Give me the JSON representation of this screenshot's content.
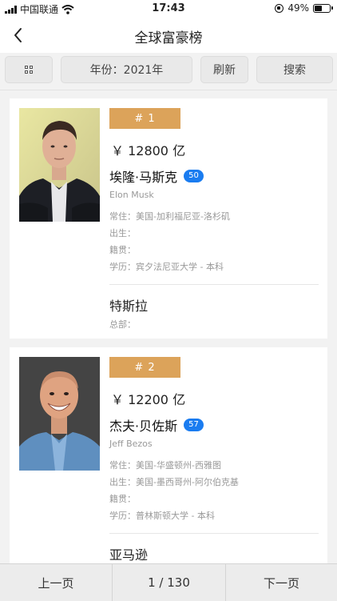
{
  "status_bar": {
    "carrier": "中国联通",
    "time": "17:43",
    "battery": "49%",
    "battery_level": 0.49
  },
  "nav": {
    "title": "全球富豪榜"
  },
  "toolbar": {
    "year_label": "年份：2021年",
    "refresh_label": "刷新",
    "search_label": "搜索"
  },
  "people": [
    {
      "rank": "# 1",
      "wealth": "￥ 12800 亿",
      "name": "埃隆·马斯克",
      "age": "50",
      "english_name": "Elon Musk",
      "residence": "常住：美国-加利福尼亚-洛杉矶",
      "birth": "出生：",
      "native": "籍贯：",
      "education": "学历：宾夕法尼亚大学 - 本科",
      "company": "特斯拉",
      "hq": "总部："
    },
    {
      "rank": "# 2",
      "wealth": "￥ 12200 亿",
      "name": "杰夫·贝佐斯",
      "age": "57",
      "english_name": "Jeff Bezos",
      "residence": "常住：美国-华盛顿州-西雅图",
      "birth": "出生：美国-墨西哥州-阿尔伯克基",
      "native": "籍贯：",
      "education": "学历：普林斯顿大学 - 本科",
      "company": "亚马逊",
      "hq": ""
    }
  ],
  "pager": {
    "prev_label": "上一页",
    "page_indicator": "1 / 130",
    "next_label": "下一页"
  }
}
